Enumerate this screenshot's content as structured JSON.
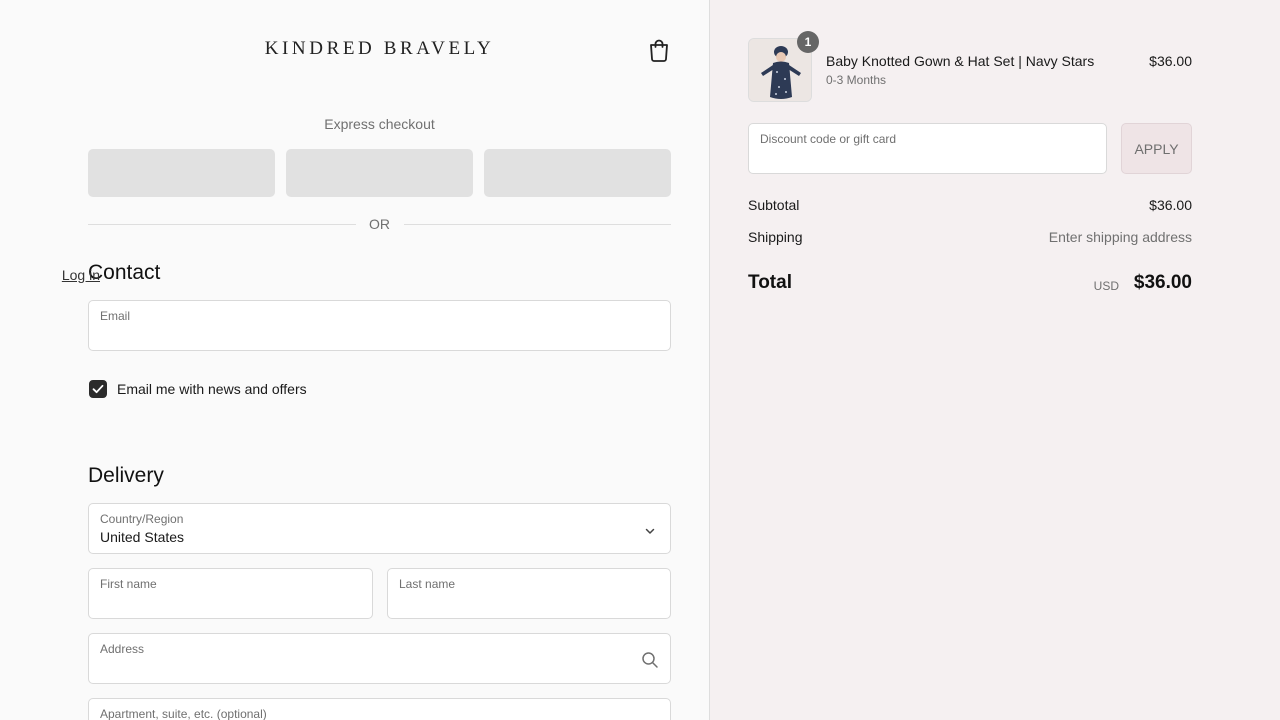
{
  "brand": {
    "logo_text": "KINDRED BRAVELY"
  },
  "express": {
    "label": "Express checkout",
    "divider": "OR"
  },
  "contact": {
    "title": "Contact",
    "login_link": "Log in",
    "email_label": "Email",
    "newsletter_label": "Email me with news and offers",
    "newsletter_checked": true
  },
  "delivery": {
    "title": "Delivery",
    "country_label": "Country/Region",
    "country_value": "United States",
    "first_name_label": "First name",
    "last_name_label": "Last name",
    "address_label": "Address",
    "apartment_label": "Apartment, suite, etc. (optional)"
  },
  "cart": {
    "item": {
      "name": "Baby Knotted Gown & Hat Set | Navy Stars",
      "variant": "0-3 Months",
      "price": "$36.00",
      "quantity": "1"
    },
    "discount_label": "Discount code or gift card",
    "apply_label": "APPLY",
    "subtotal_label": "Subtotal",
    "subtotal_value": "$36.00",
    "shipping_label": "Shipping",
    "shipping_value": "Enter shipping address",
    "total_label": "Total",
    "total_currency": "USD",
    "total_value": "$36.00"
  },
  "colors": {
    "left_bg": "#fafafa",
    "right_bg": "#f5f0f1",
    "accent_dark": "#2b2b2b",
    "apply_bg": "#efe4e6"
  }
}
